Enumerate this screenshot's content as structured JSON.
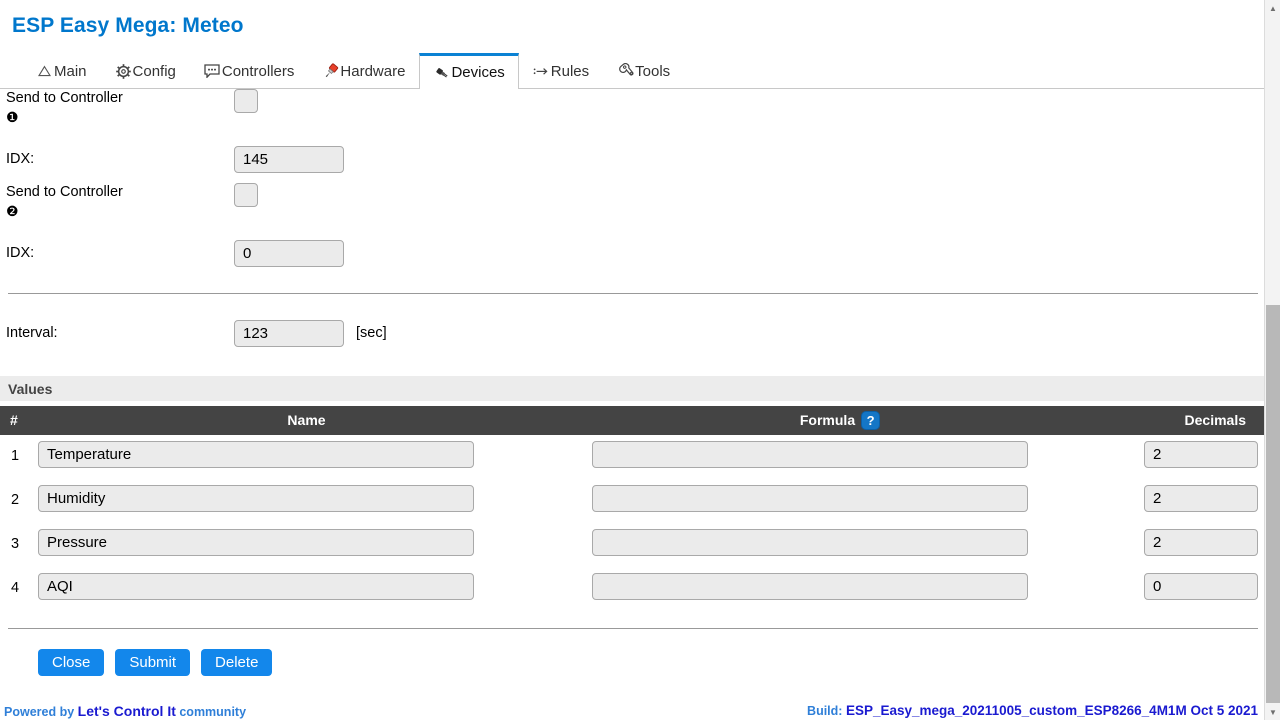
{
  "header": {
    "title": "ESP Easy Mega: Meteo"
  },
  "tabs": [
    {
      "label": "Main",
      "icon": "home-icon",
      "active": false
    },
    {
      "label": "Config",
      "icon": "gear-icon",
      "active": false
    },
    {
      "label": "Controllers",
      "icon": "chat-icon",
      "active": false
    },
    {
      "label": "Hardware",
      "icon": "pushpin-icon",
      "active": false
    },
    {
      "label": "Devices",
      "icon": "plug-icon",
      "active": true
    },
    {
      "label": "Rules",
      "icon": "rules-icon",
      "active": false
    },
    {
      "label": "Tools",
      "icon": "wrench-icon",
      "active": false
    }
  ],
  "form": {
    "controller1": {
      "label": "Send to Controller",
      "badge": "❶",
      "checked": false
    },
    "idx1": {
      "label": "IDX:",
      "value": "145"
    },
    "controller2": {
      "label": "Send to Controller",
      "badge": "❷",
      "checked": false
    },
    "idx2": {
      "label": "IDX:",
      "value": "0"
    },
    "interval": {
      "label": "Interval:",
      "value": "123",
      "unit": "[sec]"
    }
  },
  "values": {
    "section_label": "Values",
    "columns": {
      "num": "#",
      "name": "Name",
      "formula": "Formula",
      "decimals": "Decimals"
    },
    "help_icon": "question-mark-icon",
    "help_glyph": "?",
    "rows": [
      {
        "num": "1",
        "name": "Temperature",
        "formula": "",
        "decimals": "2"
      },
      {
        "num": "2",
        "name": "Humidity",
        "formula": "",
        "decimals": "2"
      },
      {
        "num": "3",
        "name": "Pressure",
        "formula": "",
        "decimals": "2"
      },
      {
        "num": "4",
        "name": "AQI",
        "formula": "",
        "decimals": "0"
      }
    ]
  },
  "buttons": {
    "close": "Close",
    "submit": "Submit",
    "delete": "Delete"
  },
  "footer": {
    "powered_by": "Powered by",
    "brand": "Let's Control It",
    "community": "community",
    "build_label": "Build:",
    "build_value": "ESP_Easy_mega_20211005_custom_ESP8266_4M1M Oct 5 2021"
  },
  "colors": {
    "accent_blue": "#0077cc",
    "button_blue": "#1387eb",
    "tab_active_border": "#0a82d4",
    "table_header_bg": "#444444",
    "input_bg": "#ebebeb"
  }
}
